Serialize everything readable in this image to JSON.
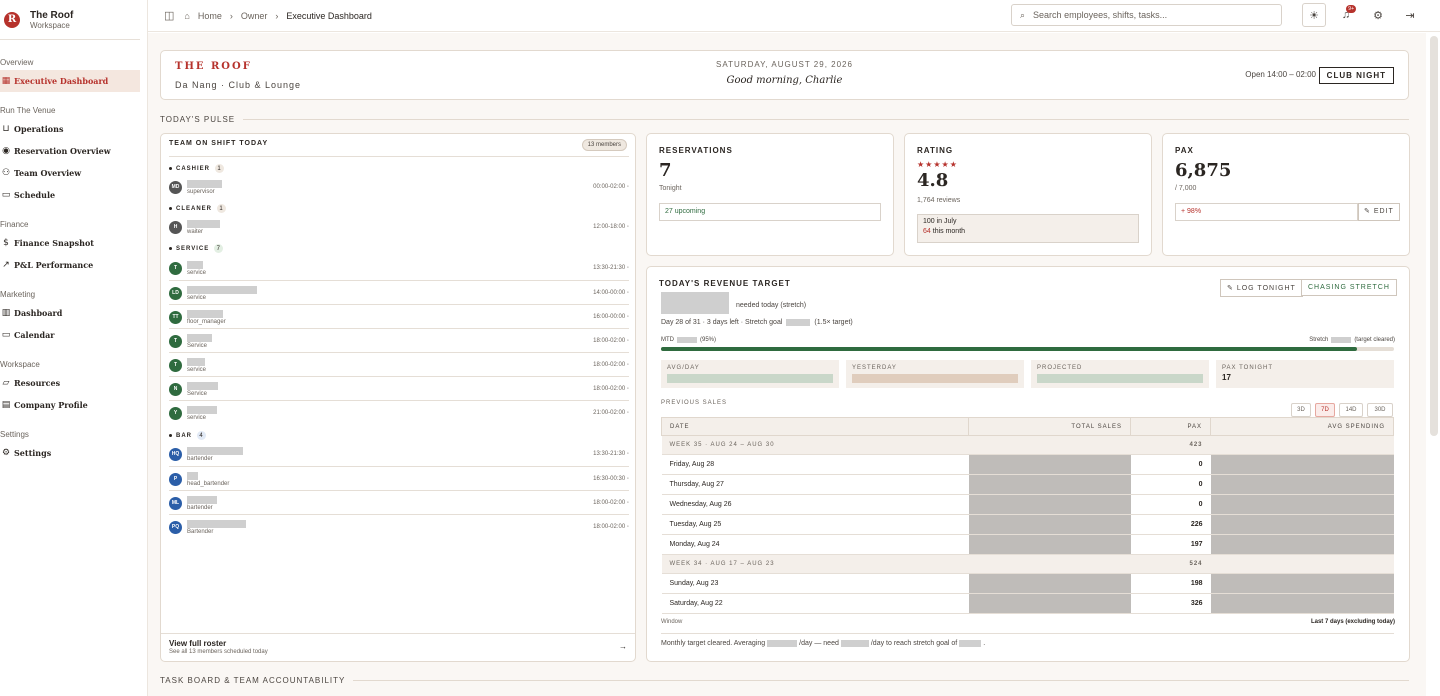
{
  "sidebar": {
    "brand": {
      "logo": "R",
      "title": "The Roof",
      "subtitle": "Workspace"
    },
    "sections": [
      {
        "label": "Overview"
      },
      {
        "label": "Run The Venue"
      },
      {
        "label": "Finance"
      },
      {
        "label": "Marketing"
      },
      {
        "label": "Workspace"
      },
      {
        "label": "Settings"
      }
    ],
    "items": [
      {
        "label": "Executive Dashboard",
        "icon": "dashboard-icon"
      },
      {
        "label": "Operations",
        "icon": "cart-icon"
      },
      {
        "label": "Reservation Overview",
        "icon": "pin-icon"
      },
      {
        "label": "Team Overview",
        "icon": "users-icon"
      },
      {
        "label": "Schedule",
        "icon": "calendar-icon"
      },
      {
        "label": "Finance Snapshot",
        "icon": "dollar-icon"
      },
      {
        "label": "P&L Performance",
        "icon": "trend-icon"
      },
      {
        "label": "Dashboard",
        "icon": "bar-chart-icon"
      },
      {
        "label": "Calendar",
        "icon": "calendar-icon"
      },
      {
        "label": "Resources",
        "icon": "folder-icon"
      },
      {
        "label": "Company Profile",
        "icon": "building-icon"
      },
      {
        "label": "Settings",
        "icon": "gear-icon"
      }
    ]
  },
  "topbar": {
    "breadcrumb": [
      "Home",
      "Owner",
      "Executive Dashboard"
    ],
    "search_placeholder": "Search employees, shifts, tasks...",
    "notif_badge": "9+"
  },
  "hero": {
    "venue": "THE ROOF",
    "location": "Da Nang · Club & Lounge",
    "date": "SATURDAY, AUGUST 29, 2026",
    "greeting": "Good morning, Charlie",
    "open_hours": "Open 14:00 – 02:00",
    "mode": "CLUB NIGHT"
  },
  "sections": {
    "pulse": "TODAY'S PULSE",
    "taskboard": "TASK BOARD & TEAM ACCOUNTABILITY"
  },
  "team": {
    "title": "TEAM ON SHIFT TODAY",
    "members_badge": "13 members",
    "groups": [
      {
        "name": "CASHIER",
        "count": "1"
      },
      {
        "name": "CLEANER",
        "count": "1"
      },
      {
        "name": "SERVICE",
        "count": "7"
      },
      {
        "name": "BAR",
        "count": "4"
      }
    ],
    "members": [
      {
        "initials": "MD",
        "role": "supervisor",
        "time": "00:00-02:00",
        "color": "#555"
      },
      {
        "initials": "H",
        "role": "waiter",
        "time": "12:00-18:00",
        "color": "#555"
      },
      {
        "initials": "T",
        "role": "service",
        "time": "13:30-21:30",
        "color": "#2f6b3f"
      },
      {
        "initials": "LD",
        "role": "service",
        "time": "14:00-00:00",
        "color": "#2f6b3f"
      },
      {
        "initials": "TT",
        "role": "floor_manager",
        "time": "16:00-00:00",
        "color": "#2f6b3f"
      },
      {
        "initials": "T",
        "role": "Service",
        "time": "18:00-02:00",
        "color": "#2f6b3f"
      },
      {
        "initials": "T",
        "role": "service",
        "time": "18:00-02:00",
        "color": "#2f6b3f"
      },
      {
        "initials": "N",
        "role": "Service",
        "time": "18:00-02:00",
        "color": "#2f6b3f"
      },
      {
        "initials": "Y",
        "role": "service",
        "time": "21:00-02:00",
        "color": "#2f6b3f"
      },
      {
        "initials": "HQ",
        "role": "bartender",
        "time": "13:30-21:30",
        "color": "#2b5ea8"
      },
      {
        "initials": "P",
        "role": "head_bartender",
        "time": "16:30-00:30",
        "color": "#2b5ea8"
      },
      {
        "initials": "ML",
        "role": "bartender",
        "time": "18:00-02:00",
        "color": "#2b5ea8"
      },
      {
        "initials": "PQ",
        "role": "Bartender",
        "time": "18:00-02:00",
        "color": "#2b5ea8"
      }
    ],
    "roster_title": "View full roster",
    "roster_sub": "See all 13 members scheduled today"
  },
  "reservations": {
    "label": "RESERVATIONS",
    "value": "7",
    "sub": "Tonight",
    "upcoming": "27 upcoming"
  },
  "rating": {
    "label": "RATING",
    "stars": "★★★★★",
    "value": "4.8",
    "reviews": "1,764 reviews",
    "july": "100 in July",
    "month_count": "64",
    "month_label": "this month"
  },
  "pax": {
    "label": "PAX",
    "value": "6,875",
    "target": "/ 7,000",
    "delta": "+ 98%",
    "edit": "EDIT"
  },
  "revenue": {
    "title": "TODAY'S REVENUE TARGET",
    "needed": "needed today (stretch)",
    "day_pre": "Day 28 of 31 · 3 days left · Stretch goal",
    "day_post": "(1.5× target)",
    "mtd_label": "MTD",
    "mtd_pct": "(95%)",
    "stretch_label": "Stretch",
    "stretch_note": "(target cleared)",
    "progress": 0.95,
    "log_btn": "LOG TONIGHT",
    "chase_btn": "CHASING STRETCH",
    "stats": [
      "AVG/DAY",
      "YESTERDAY",
      "PROJECTED",
      "PAX TONIGHT"
    ],
    "pax_tonight": "17",
    "prev_label": "PREVIOUS SALES",
    "ranges": [
      "3D",
      "7D",
      "14D",
      "30D"
    ],
    "headers": [
      "DATE",
      "TOTAL SALES",
      "PAX",
      "AVG SPENDING"
    ],
    "rows": [
      {
        "type": "week",
        "date": "WEEK 35 · AUG 24 – AUG 30",
        "pax": "423"
      },
      {
        "type": "day",
        "date": "Friday, Aug 28",
        "pax": "0"
      },
      {
        "type": "day",
        "date": "Thursday, Aug 27",
        "pax": "0"
      },
      {
        "type": "day",
        "date": "Wednesday, Aug 26",
        "pax": "0"
      },
      {
        "type": "day",
        "date": "Tuesday, Aug 25",
        "pax": "226"
      },
      {
        "type": "day",
        "date": "Monday, Aug 24",
        "pax": "197"
      },
      {
        "type": "week",
        "date": "WEEK 34 · AUG 17 – AUG 23",
        "pax": "524"
      },
      {
        "type": "day",
        "date": "Sunday, Aug 23",
        "pax": "198"
      },
      {
        "type": "day",
        "date": "Saturday, Aug 22",
        "pax": "326"
      }
    ],
    "window_label": "Window",
    "window_value": "Last 7 days (excluding today)",
    "footer_a": "Monthly target cleared. Averaging",
    "footer_b": "/day — need",
    "footer_c": "/day to reach stretch goal of",
    "footer_d": "."
  },
  "colors": {
    "accent": "#b6322c",
    "progress": "#2f6b3f",
    "service": "#2f6b3f",
    "bar": "#2b5ea8"
  }
}
